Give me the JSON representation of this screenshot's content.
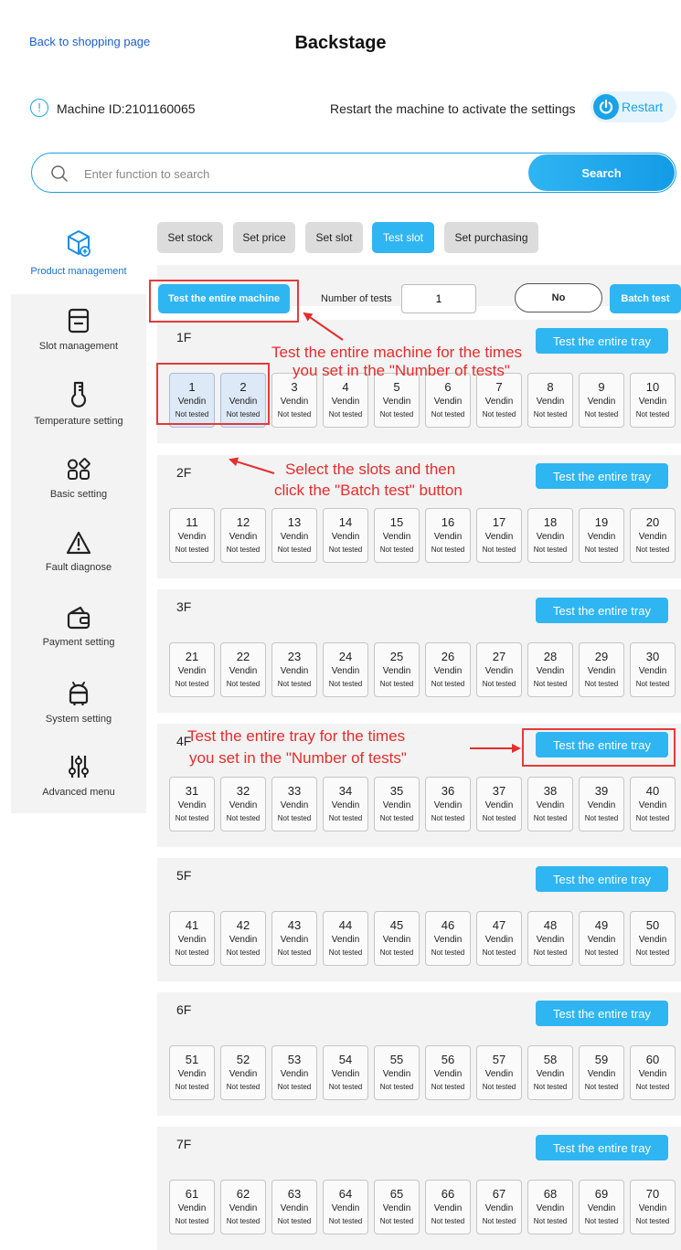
{
  "header": {
    "back_link": "Back to shopping page",
    "title": "Backstage"
  },
  "machine": {
    "id_label": "Machine ID:2101160065",
    "restart_note": "Restart the machine to activate the settings",
    "restart_label": "Restart"
  },
  "search": {
    "placeholder": "Enter function to search",
    "value": "",
    "button_label": "Search"
  },
  "sidebar": {
    "items": [
      {
        "label": "Product management",
        "icon": "box-plus-icon",
        "active": true
      },
      {
        "label": "Slot management",
        "icon": "drawer-icon"
      },
      {
        "label": "Temperature setting",
        "icon": "thermometer-icon"
      },
      {
        "label": "Basic setting",
        "icon": "apps-grid-icon"
      },
      {
        "label": "Fault diagnose",
        "icon": "warning-icon"
      },
      {
        "label": "Payment setting",
        "icon": "wallet-icon"
      },
      {
        "label": "System setting",
        "icon": "android-icon"
      },
      {
        "label": "Advanced menu",
        "icon": "sliders-icon"
      }
    ]
  },
  "tabs": [
    {
      "label": "Set stock"
    },
    {
      "label": "Set price"
    },
    {
      "label": "Set slot"
    },
    {
      "label": "Test slot",
      "active": true
    },
    {
      "label": "Set purchasing"
    }
  ],
  "toolbar": {
    "test_machine_label": "Test the entire machine",
    "num_tests_label": "Number of tests",
    "num_tests_value": "1",
    "no_label": "No",
    "batch_label": "Batch test"
  },
  "tray_button_label": "Test the entire tray",
  "slot_product": "Vendin",
  "slot_status": "Not tested",
  "trays": [
    {
      "floor": "1F",
      "slots": [
        1,
        2,
        3,
        4,
        5,
        6,
        7,
        8,
        9,
        10
      ],
      "selected": [
        1,
        2
      ]
    },
    {
      "floor": "2F",
      "slots": [
        11,
        12,
        13,
        14,
        15,
        16,
        17,
        18,
        19,
        20
      ]
    },
    {
      "floor": "3F",
      "slots": [
        21,
        22,
        23,
        24,
        25,
        26,
        27,
        28,
        29,
        30
      ]
    },
    {
      "floor": "4F",
      "slots": [
        31,
        32,
        33,
        34,
        35,
        36,
        37,
        38,
        39,
        40
      ]
    },
    {
      "floor": "5F",
      "slots": [
        41,
        42,
        43,
        44,
        45,
        46,
        47,
        48,
        49,
        50
      ]
    },
    {
      "floor": "6F",
      "slots": [
        51,
        52,
        53,
        54,
        55,
        56,
        57,
        58,
        59,
        60
      ]
    },
    {
      "floor": "7F",
      "slots": [
        61,
        62,
        63,
        64,
        65,
        66,
        67,
        68,
        69,
        70
      ]
    }
  ],
  "annotations": {
    "machine_line1": "Test the entire machine for the times",
    "machine_line2": "you set in the \"Number of tests\"",
    "batch_line1": "Select the slots and then",
    "batch_line2": "click the \"Batch test\" button",
    "tray_line1": "Test the entire tray for the times",
    "tray_line2": "you set in the \"Number of tests\""
  },
  "colors": {
    "accent": "#2fb5f2",
    "annotation": "#e52d2d"
  }
}
